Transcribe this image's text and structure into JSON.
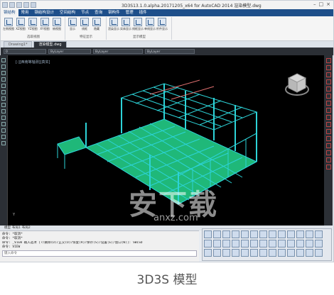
{
  "window": {
    "title": "3D3S13.1.0.alpha.20171205_x64 for AutoCAD 2014    渲染模型.dwg",
    "controls": [
      "–",
      "□",
      "×"
    ]
  },
  "ribbon": {
    "tabs": [
      "钢结构",
      "常用",
      "钢结构设计",
      "空间结构",
      "节点",
      "查询",
      "钢构件",
      "管理",
      "插件"
    ],
    "groups": [
      {
        "caption": "选取视图",
        "buttons": [
          "左侧视图",
          "XZ视图",
          "YZ视图",
          "XY视图",
          "俯视图"
        ]
      },
      {
        "caption": "特征显示",
        "buttons": [
          "显示",
          "线框",
          "隐藏"
        ]
      },
      {
        "caption": "显示模型",
        "buttons": [
          "渲染显示",
          "实体显示",
          "线框显示",
          "单线显示",
          "杆件显示"
        ]
      }
    ]
  },
  "file_tabs": [
    {
      "label": "Drawing1*",
      "active": false
    },
    {
      "label": "渲染模型.dwg",
      "active": true
    }
  ],
  "properties": {
    "layer": "0",
    "color": "ByLayer",
    "linetype": "ByLayer",
    "lineweight": "ByLayer"
  },
  "viewport": {
    "nav_label": "[-][西南等轴测][真实]",
    "ucs_label": "Y",
    "watermark_main": "安下载",
    "watermark_sub": "anxz.com"
  },
  "layout_tabs": [
    "模型",
    "布局1",
    "布局2"
  ],
  "command_line": {
    "lines": [
      "命令: *取消*",
      "命令: *取消*",
      "命令: _VIEW 输入选项 [?/删除(D)/正交(O)/恢复(R)/保存(S)/设置(E)/窗口(W)]: SWISO",
      "命令: VIEW"
    ],
    "placeholder": "键入命令"
  },
  "caption": "3D3S 模型",
  "colors": {
    "ribbon_blue": "#1e4f8a",
    "model_green": "#2ee08a",
    "model_cyan": "#2dd3d8",
    "viewport_bg": "#000000"
  }
}
